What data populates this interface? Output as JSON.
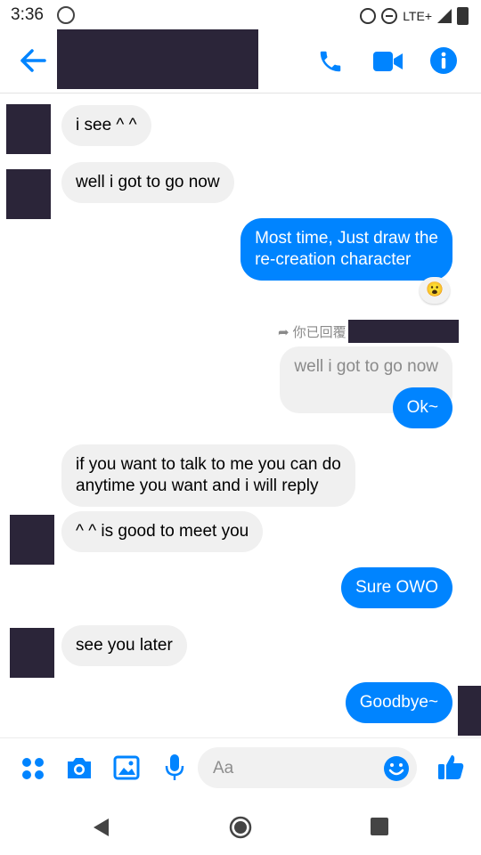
{
  "status": {
    "time": "3:36",
    "network": "LTE+"
  },
  "messages": {
    "m1": "i see ^ ^",
    "m2": "well i got to go now",
    "m3_line1": "Most time, Just draw the",
    "m3_line2": "re-creation character",
    "reply_label": "你已回覆",
    "reply_quote": "well i got to go now",
    "m4": "Ok~",
    "m5_line1": "if you want to talk to me you can do",
    "m5_line2": "anytime you want and i will reply",
    "m6": "^ ^ is good to meet you",
    "m7": "Sure OWO",
    "m8": "see you later",
    "m9": "Goodbye~"
  },
  "reaction": {
    "emoji": "😮"
  },
  "composer": {
    "placeholder": "Aa"
  },
  "colors": {
    "accent": "#0084ff",
    "incoming_bg": "#f0f0f0",
    "redaction": "#2b2539"
  }
}
